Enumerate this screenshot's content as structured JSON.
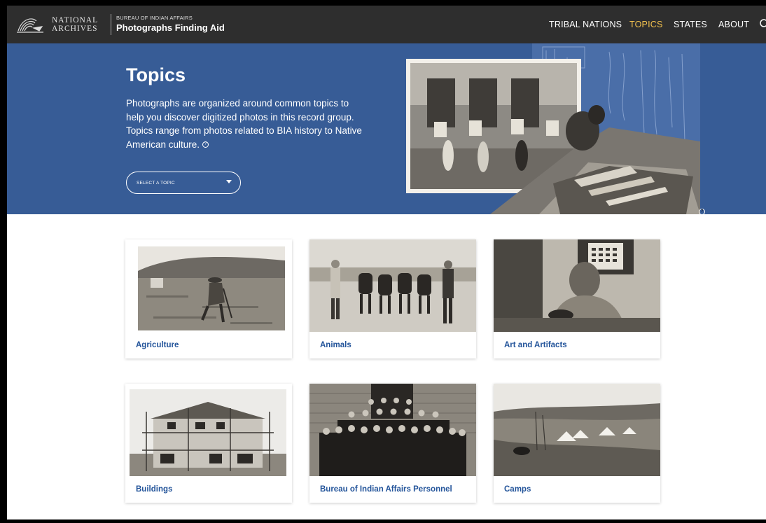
{
  "header": {
    "logo_line1": "NATIONAL",
    "logo_line2": "ARCHIVES",
    "subtitle": "BUREAU OF INDIAN AFFAIRS",
    "title": "Photographs Finding Aid",
    "nav": [
      {
        "label": "TRIBAL NATIONS",
        "active": false
      },
      {
        "label": "TOPICS",
        "active": true
      },
      {
        "label": "STATES",
        "active": false
      },
      {
        "label": "ABOUT",
        "active": false
      }
    ],
    "accent_color": "#f2c14e",
    "bar_color": "#2e2e2e"
  },
  "hero": {
    "title": "Topics",
    "description": "Photographs are organized around common topics to help you discover digitized photos in this record group. Topics range from photos related to BIA history to Native American culture.",
    "select_label": "SELECT A TOPIC",
    "background_color": "#375c96"
  },
  "topics": [
    {
      "label": "Agriculture",
      "photo": "farmer-working-field"
    },
    {
      "label": "Animals",
      "photo": "men-with-horses"
    },
    {
      "label": "Art and Artifacts",
      "photo": "artisan-carving"
    },
    {
      "label": "Buildings",
      "photo": "building-under-construction"
    },
    {
      "label": "Bureau of Indian Affairs Personnel",
      "photo": "group-portrait-personnel"
    },
    {
      "label": "Camps",
      "photo": "tents-in-valley"
    }
  ],
  "link_color": "#23549a"
}
